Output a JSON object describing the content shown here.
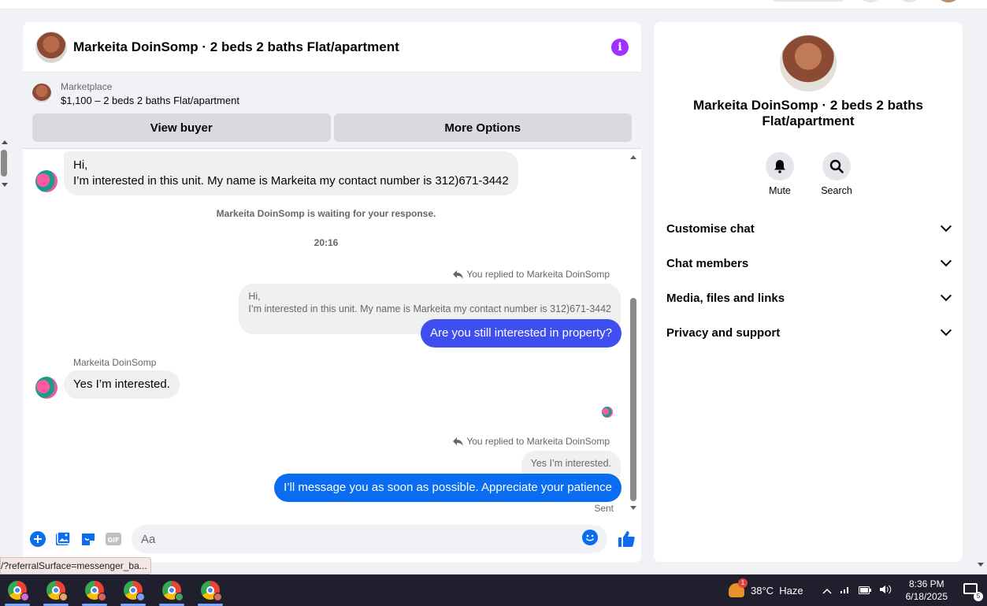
{
  "chat": {
    "title": "Markeita DoinSomp · 2 beds 2 baths Flat/apartment",
    "marketplace_label": "Marketplace",
    "listing": "$1,100 – 2 beds 2 baths Flat/apartment",
    "view_buyer": "View buyer",
    "more_options": "More Options"
  },
  "messages": {
    "first_line1": "Hi,",
    "first_line2": "I’m interested in this unit. My name is Markeita my contact number is 312)671-3442",
    "waiting": "Markeita DoinSomp is waiting for your response.",
    "time": "20:16",
    "replied_to_1": "You replied to Markeita DoinSomp",
    "quote_line1": "Hi,",
    "quote_line2": "I’m interested in this unit. My name is Markeita my contact number is 312)671-3442",
    "reply_1": "Are you still interested in property?",
    "sender_name": "Markeita DoinSomp",
    "incoming_2": "Yes I’m interested.",
    "replied_to_2": "You replied to Markeita DoinSomp",
    "quote_2": "Yes I’m interested.",
    "reply_2": "I’ll message you as soon as possible. Appreciate your patience",
    "status": "Sent"
  },
  "composer": {
    "placeholder": "Aa"
  },
  "right_panel": {
    "title": "Markeita DoinSomp · 2 beds 2 baths Flat/apartment",
    "mute": "Mute",
    "search": "Search",
    "menu": [
      "Customise chat",
      "Chat members",
      "Media, files and links",
      "Privacy and support"
    ]
  },
  "status_url": "/?referralSurface=messenger_ba...",
  "taskbar": {
    "weather_badge": "1",
    "weather": "38°C  Haze",
    "time": "8:36 PM",
    "date": "6/18/2025",
    "notifications": "5"
  },
  "colors": {
    "accent_blue": "#0a6cf0",
    "reply_blue": "#3f4ef0",
    "info_purple": "#a033ff"
  }
}
